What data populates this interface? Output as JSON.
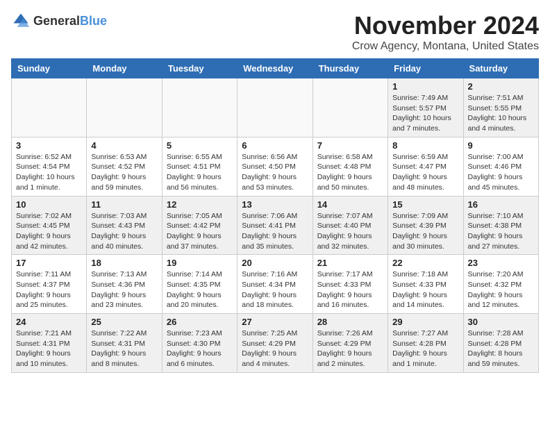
{
  "logo": {
    "general": "General",
    "blue": "Blue"
  },
  "title": "November 2024",
  "location": "Crow Agency, Montana, United States",
  "headers": [
    "Sunday",
    "Monday",
    "Tuesday",
    "Wednesday",
    "Thursday",
    "Friday",
    "Saturday"
  ],
  "rows": [
    [
      {
        "day": "",
        "info": ""
      },
      {
        "day": "",
        "info": ""
      },
      {
        "day": "",
        "info": ""
      },
      {
        "day": "",
        "info": ""
      },
      {
        "day": "",
        "info": ""
      },
      {
        "day": "1",
        "info": "Sunrise: 7:49 AM\nSunset: 5:57 PM\nDaylight: 10 hours\nand 7 minutes."
      },
      {
        "day": "2",
        "info": "Sunrise: 7:51 AM\nSunset: 5:55 PM\nDaylight: 10 hours\nand 4 minutes."
      }
    ],
    [
      {
        "day": "3",
        "info": "Sunrise: 6:52 AM\nSunset: 4:54 PM\nDaylight: 10 hours\nand 1 minute."
      },
      {
        "day": "4",
        "info": "Sunrise: 6:53 AM\nSunset: 4:52 PM\nDaylight: 9 hours\nand 59 minutes."
      },
      {
        "day": "5",
        "info": "Sunrise: 6:55 AM\nSunset: 4:51 PM\nDaylight: 9 hours\nand 56 minutes."
      },
      {
        "day": "6",
        "info": "Sunrise: 6:56 AM\nSunset: 4:50 PM\nDaylight: 9 hours\nand 53 minutes."
      },
      {
        "day": "7",
        "info": "Sunrise: 6:58 AM\nSunset: 4:48 PM\nDaylight: 9 hours\nand 50 minutes."
      },
      {
        "day": "8",
        "info": "Sunrise: 6:59 AM\nSunset: 4:47 PM\nDaylight: 9 hours\nand 48 minutes."
      },
      {
        "day": "9",
        "info": "Sunrise: 7:00 AM\nSunset: 4:46 PM\nDaylight: 9 hours\nand 45 minutes."
      }
    ],
    [
      {
        "day": "10",
        "info": "Sunrise: 7:02 AM\nSunset: 4:45 PM\nDaylight: 9 hours\nand 42 minutes."
      },
      {
        "day": "11",
        "info": "Sunrise: 7:03 AM\nSunset: 4:43 PM\nDaylight: 9 hours\nand 40 minutes."
      },
      {
        "day": "12",
        "info": "Sunrise: 7:05 AM\nSunset: 4:42 PM\nDaylight: 9 hours\nand 37 minutes."
      },
      {
        "day": "13",
        "info": "Sunrise: 7:06 AM\nSunset: 4:41 PM\nDaylight: 9 hours\nand 35 minutes."
      },
      {
        "day": "14",
        "info": "Sunrise: 7:07 AM\nSunset: 4:40 PM\nDaylight: 9 hours\nand 32 minutes."
      },
      {
        "day": "15",
        "info": "Sunrise: 7:09 AM\nSunset: 4:39 PM\nDaylight: 9 hours\nand 30 minutes."
      },
      {
        "day": "16",
        "info": "Sunrise: 7:10 AM\nSunset: 4:38 PM\nDaylight: 9 hours\nand 27 minutes."
      }
    ],
    [
      {
        "day": "17",
        "info": "Sunrise: 7:11 AM\nSunset: 4:37 PM\nDaylight: 9 hours\nand 25 minutes."
      },
      {
        "day": "18",
        "info": "Sunrise: 7:13 AM\nSunset: 4:36 PM\nDaylight: 9 hours\nand 23 minutes."
      },
      {
        "day": "19",
        "info": "Sunrise: 7:14 AM\nSunset: 4:35 PM\nDaylight: 9 hours\nand 20 minutes."
      },
      {
        "day": "20",
        "info": "Sunrise: 7:16 AM\nSunset: 4:34 PM\nDaylight: 9 hours\nand 18 minutes."
      },
      {
        "day": "21",
        "info": "Sunrise: 7:17 AM\nSunset: 4:33 PM\nDaylight: 9 hours\nand 16 minutes."
      },
      {
        "day": "22",
        "info": "Sunrise: 7:18 AM\nSunset: 4:33 PM\nDaylight: 9 hours\nand 14 minutes."
      },
      {
        "day": "23",
        "info": "Sunrise: 7:20 AM\nSunset: 4:32 PM\nDaylight: 9 hours\nand 12 minutes."
      }
    ],
    [
      {
        "day": "24",
        "info": "Sunrise: 7:21 AM\nSunset: 4:31 PM\nDaylight: 9 hours\nand 10 minutes."
      },
      {
        "day": "25",
        "info": "Sunrise: 7:22 AM\nSunset: 4:31 PM\nDaylight: 9 hours\nand 8 minutes."
      },
      {
        "day": "26",
        "info": "Sunrise: 7:23 AM\nSunset: 4:30 PM\nDaylight: 9 hours\nand 6 minutes."
      },
      {
        "day": "27",
        "info": "Sunrise: 7:25 AM\nSunset: 4:29 PM\nDaylight: 9 hours\nand 4 minutes."
      },
      {
        "day": "28",
        "info": "Sunrise: 7:26 AM\nSunset: 4:29 PM\nDaylight: 9 hours\nand 2 minutes."
      },
      {
        "day": "29",
        "info": "Sunrise: 7:27 AM\nSunset: 4:28 PM\nDaylight: 9 hours\nand 1 minute."
      },
      {
        "day": "30",
        "info": "Sunrise: 7:28 AM\nSunset: 4:28 PM\nDaylight: 8 hours\nand 59 minutes."
      }
    ]
  ]
}
